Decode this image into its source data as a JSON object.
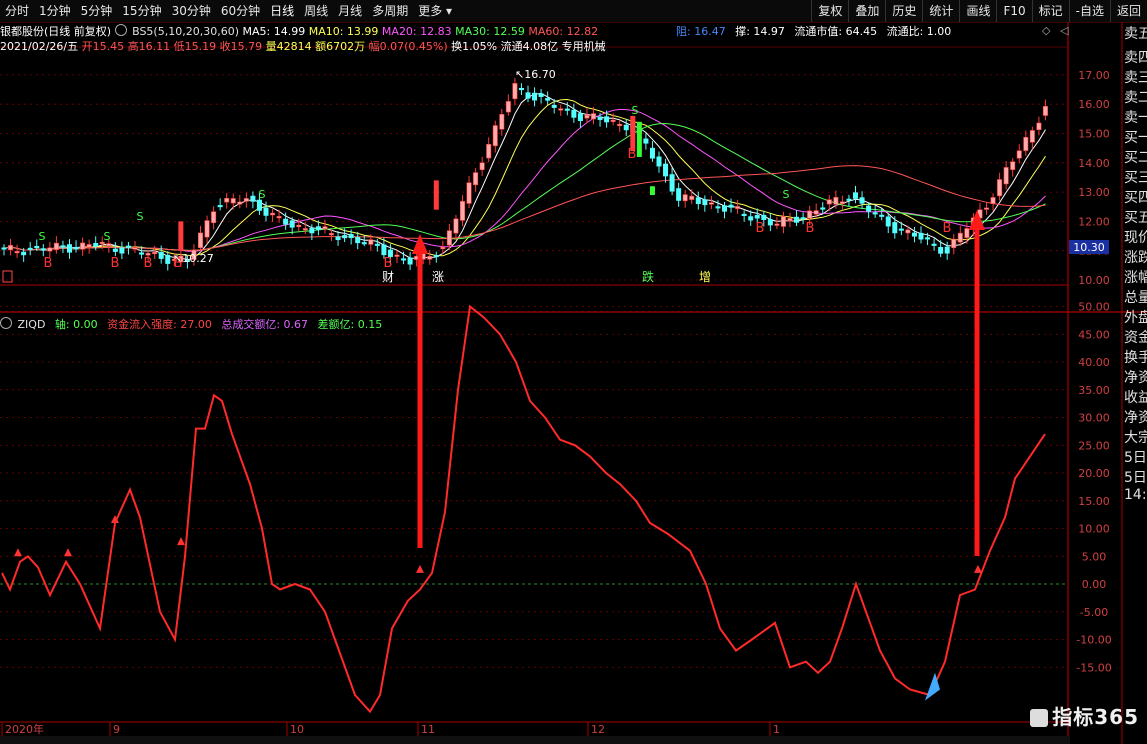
{
  "toolbar": {
    "items": [
      "分时",
      "1分钟",
      "5分钟",
      "15分钟",
      "30分钟",
      "60分钟",
      "日线",
      "周线",
      "月线",
      "多周期",
      "更多"
    ],
    "right_buttons": [
      "复权",
      "叠加",
      "历史",
      "统计",
      "画线",
      "F10",
      "标记",
      "-自选",
      "返回"
    ]
  },
  "kline_info": {
    "stock": "银都股份(日线 前复权)",
    "indicator": "BS5(5,10,20,30,60)",
    "ma5": "MA5: 14.99",
    "ma10": "MA10: 13.99",
    "ma20": "MA20: 12.83",
    "ma30": "MA30: 12.59",
    "ma60": "MA60: 12.82",
    "date": "2021/02/26/五",
    "open": "开15.45",
    "high": "高16.11",
    "low": "低15.19",
    "close": "收15.79",
    "volume": "量42814",
    "amount": "额6702万",
    "change": "幅0.07(0.45%)",
    "turnover": "换1.05%",
    "float_shares": "流通4.08亿",
    "sector": "专用机械",
    "support": "撑: 14.97",
    "float_value": "流通市值: 64.45",
    "float_ratio": "流通比: 1.00",
    "pressure": "阻: 16.47"
  },
  "price_axis": [
    "17.00",
    "16.00",
    "15.00",
    "14.00",
    "13.00",
    "12.00",
    "11.00",
    "10.00"
  ],
  "current_price": "10.30",
  "annotations": {
    "high": "16.70",
    "low": "10.27"
  },
  "event_tags": [
    "财",
    "涨",
    "跌",
    "增"
  ],
  "signal_b": "B",
  "signal_s": "S",
  "ind_info": {
    "name": "ZIQD",
    "axis": "轴: 0.00",
    "inflow": "资金流入强度: 27.00",
    "total_amount": "总成交额亿: 0.67",
    "diff_amount": "差额亿: 0.15"
  },
  "ind_axis": [
    "50.00",
    "45.00",
    "40.00",
    "35.00",
    "30.00",
    "25.00",
    "20.00",
    "15.00",
    "10.00",
    "5.00",
    "0.00",
    "-5.00",
    "-10.00",
    "-15.00"
  ],
  "time_axis": [
    "2020年",
    "9",
    "10",
    "11",
    "12",
    "1"
  ],
  "right_panel": [
    "卖五",
    "卖四",
    "卖三",
    "卖二",
    "卖一",
    "买一",
    "买二",
    "买三",
    "买四",
    "买五",
    "现价",
    "涨跌",
    "涨幅",
    "总量",
    "外盘",
    "资金",
    "换手",
    "净资",
    "收益",
    "净资",
    "大宗",
    "5日",
    "5日",
    "14:5"
  ],
  "watermark": "指标365",
  "colors": {
    "up": "#ff3b3b",
    "down": "#54ffff",
    "ma5": "#ffffff",
    "ma10": "#ffff55",
    "ma20": "#ff55ff",
    "ma30": "#55ff55",
    "ma60": "#ff5555",
    "zero_line": "#2e8b2e",
    "grid": "#7a0000"
  }
}
